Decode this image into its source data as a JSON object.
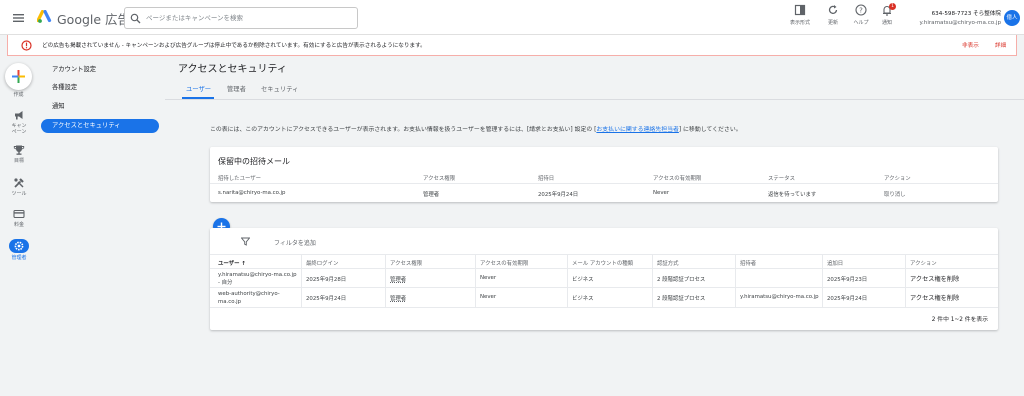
{
  "topbar": {
    "brand": "Google 広告",
    "search_placeholder": "ページまたはキャンペーンを検索",
    "tools": [
      {
        "label": "表示形式",
        "icon": "appearance-icon"
      },
      {
        "label": "更新",
        "icon": "refresh-icon"
      },
      {
        "label": "ヘルプ",
        "icon": "help-icon"
      },
      {
        "label": "通知",
        "icon": "bell-icon"
      }
    ],
    "notification_count": "1",
    "account_line1": "634-598-7723 そら整体院",
    "account_line2": "y.hiramatsu@chiryo-ma.co.jp",
    "avatar_text": "億人"
  },
  "alert": {
    "message": "どの広告も掲載されていません - キャンペーンおよび広告グループは停止中であるか削除されています。有効にすると広告が表示されるようになります。",
    "hide": "非表示",
    "details": "詳細"
  },
  "rail": {
    "create_label": "作成",
    "items": [
      {
        "label": "キャン\nペーン",
        "icon": "campaign-icon"
      },
      {
        "label": "目標",
        "icon": "trophy-icon"
      },
      {
        "label": "ツール",
        "icon": "tools-icon"
      },
      {
        "label": "料金",
        "icon": "billing-icon"
      },
      {
        "label": "管理者",
        "icon": "admin-gear-icon"
      }
    ]
  },
  "submenu": [
    "アカウント設定",
    "各種設定",
    "通知",
    "アクセスとセキュリティ"
  ],
  "page": {
    "title": "アクセスとセキュリティ",
    "tabs": [
      "ユーザー",
      "管理者",
      "セキュリティ"
    ],
    "description_before": "この表には、このアカウントにアクセスできるユーザーが表示されます。お支払い情報を扱うユーザーを管理するには、[請求とお支払い] 設定の [",
    "description_link": "お支払いに関する連絡先担当者",
    "description_after": "] に移動してください。"
  },
  "pending": {
    "title": "保留中の招待メール",
    "headers": [
      "招待したユーザー",
      "アクセス権限",
      "招待日",
      "アクセスの有効期限",
      "ステータス",
      "アクション"
    ],
    "rows": [
      [
        "s.narita@chiryo-ma.co.jp",
        "管理者",
        "2025年9月24日",
        "Never",
        "返信を待っています",
        "取り消し"
      ]
    ]
  },
  "users": {
    "filter_label": "フィルタを追加",
    "headers": [
      "ユーザー",
      "最終ログイン",
      "アクセス権限",
      "アクセスの有効期限",
      "メール アカウントの種類",
      "認証方式",
      "招待者",
      "追加日",
      "アクション"
    ],
    "sort_arrow": "↑",
    "rows": [
      {
        "user": "y.hiramatsu@chiryo-ma.co.jp",
        "user_suffix": "- 自分",
        "last_login": "2025年9月28日",
        "access": "管理者",
        "expiry": "Never",
        "account_type": "ビジネス",
        "auth": "2 段階認証プロセス",
        "inviter": "",
        "added": "2025年9月23日",
        "action": "アクセス権を削除"
      },
      {
        "user": "web-authority@chiryo-",
        "user_suffix": "ma.co.jp",
        "last_login": "2025年9月24日",
        "access": "管理者",
        "expiry": "Never",
        "account_type": "ビジネス",
        "auth": "2 段階認証プロセス",
        "inviter": "y.hiramatsu@chiryo-ma.co.jp",
        "added": "2025年9月24日",
        "action": "アクセス権を削除"
      }
    ],
    "pager": "2 件中 1~2 件を表示"
  }
}
